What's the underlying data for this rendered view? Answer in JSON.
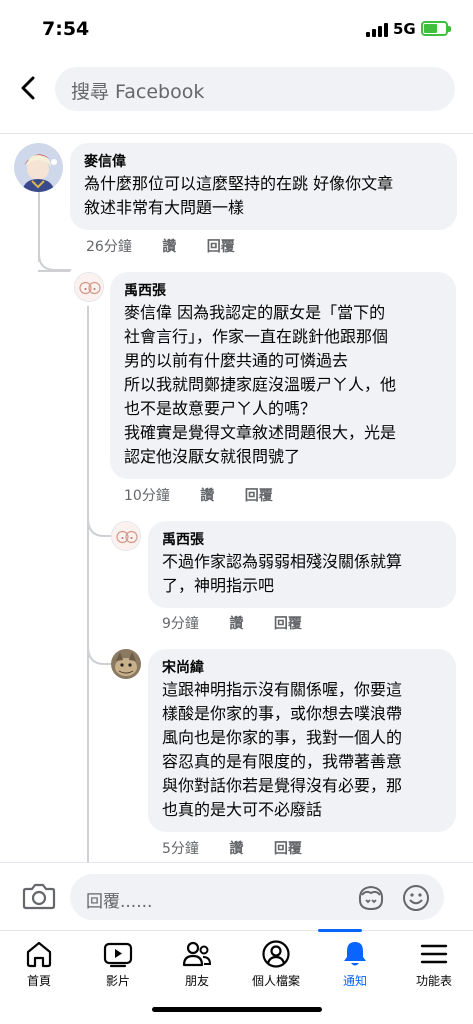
{
  "status_bar": {
    "time": "7:54",
    "network": "5G",
    "battery_color": "#3ec03e"
  },
  "header": {
    "search_placeholder": "搜尋 Facebook",
    "back_icon": "chevron-left-icon"
  },
  "comments": [
    {
      "author": "麥信偉",
      "text": "為什麼那位可以這麼堅持的在跳 好像你文章\n敘述非常有大問題一樣",
      "time": "26分鐘",
      "like": "讚",
      "reply": "回覆"
    },
    {
      "author": "禹西張",
      "text": "麥信偉 因為我認定的厭女是「當下的\n社會言行」，作家一直在跳針他跟那個\n男的以前有什麼共通的可憐過去\n所以我就問鄭捷家庭沒溫暖ㄕㄚ人，他\n也不是故意要ㄕㄚ人的嗎？\n我確實是覺得文章敘述問題很大，光是\n認定他沒厭女就很問號了",
      "time": "10分鐘",
      "like": "讚",
      "reply": "回覆"
    },
    {
      "author": "禹西張",
      "text": "不過作家認為弱弱相殘沒關係就算\n了，神明指示吧",
      "time": "9分鐘",
      "like": "讚",
      "reply": "回覆"
    },
    {
      "author": "宋尚緯",
      "text": "這跟神明指示沒有關係喔，你要這\n樣酸是你家的事，或你想去噗浪帶\n風向也是你家的事，我對一個人的\n容忍真的是有限度的，我帶著善意\n與你對話你若是覺得沒有必要，那\n也真的是大可不必廢話",
      "time": "5分鐘",
      "like": "讚",
      "reply": "回覆"
    }
  ],
  "reply_bar": {
    "placeholder": "回覆......"
  },
  "bottom_nav": {
    "items": [
      {
        "label": "首頁",
        "icon": "home-icon"
      },
      {
        "label": "影片",
        "icon": "video-icon"
      },
      {
        "label": "朋友",
        "icon": "friends-icon"
      },
      {
        "label": "個人檔案",
        "icon": "profile-icon"
      },
      {
        "label": "通知",
        "icon": "bell-icon",
        "active": true
      },
      {
        "label": "功能表",
        "icon": "menu-icon"
      }
    ],
    "active_color": "#0866ff"
  }
}
